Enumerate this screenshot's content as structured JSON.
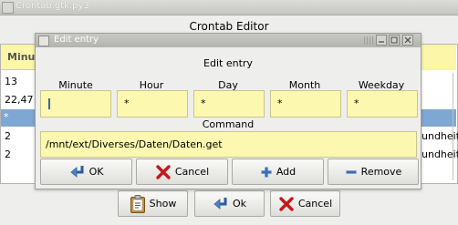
{
  "main_window": {
    "titlebar_text": "Crontab.gtk.py3",
    "heading": "Crontab Editor",
    "column_header": "Minute",
    "rows": [
      "13",
      "22,47",
      "*",
      "2",
      "2"
    ],
    "right_rows": [
      "undheit/",
      "undheit/"
    ],
    "buttons": {
      "show": "Show",
      "ok": "Ok",
      "cancel": "Cancel"
    }
  },
  "dialog": {
    "titlebar_text": "Edit entry",
    "heading": "Edit entry",
    "fields": [
      {
        "label": "Minute",
        "value": ""
      },
      {
        "label": "Hour",
        "value": "*"
      },
      {
        "label": "Day",
        "value": "*"
      },
      {
        "label": "Month",
        "value": "*"
      },
      {
        "label": "Weekday",
        "value": "*"
      }
    ],
    "command_label": "Command",
    "command_value": "/mnt/ext/Diverses/Daten/Daten.get",
    "buttons": {
      "ok": "OK",
      "cancel": "Cancel",
      "add": "Add",
      "remove": "Remove"
    }
  }
}
